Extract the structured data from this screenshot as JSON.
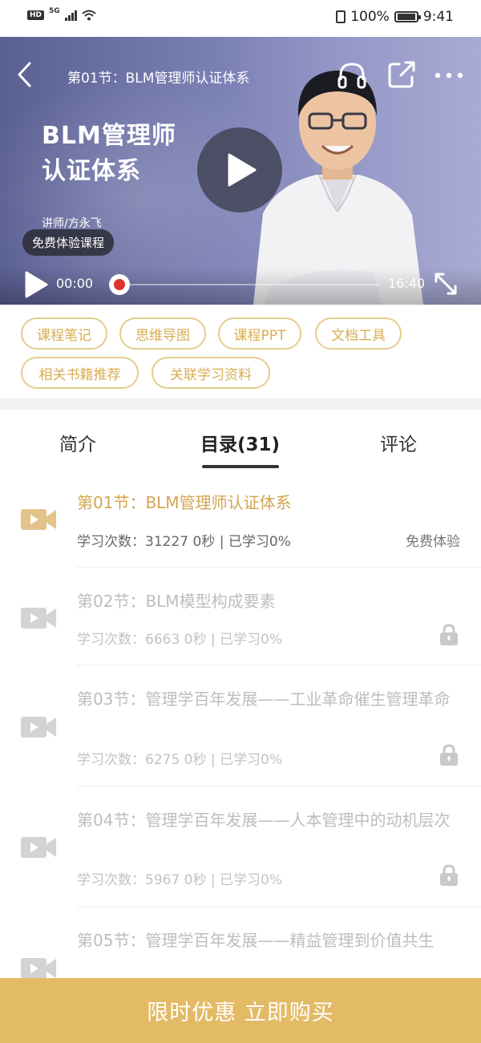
{
  "status_bar": {
    "hd": "HD",
    "network": "5G",
    "battery_percent": "100%",
    "time": "9:41"
  },
  "video": {
    "title": "第01节：BLM管理师认证体系",
    "course_name_line1": "BLM管理师",
    "course_name_line2": "认证体系",
    "teacher": "讲师/方永飞",
    "trial_badge": "免费体验课程",
    "current_time": "00:00",
    "total_time": "16:40",
    "progress": 0,
    "icons": [
      "back-icon",
      "headphone-icon",
      "share-icon",
      "more-icon",
      "play-icon",
      "record-icon",
      "fullscreen-icon"
    ]
  },
  "tools": {
    "tags": [
      "课程笔记",
      "思维导图",
      "课程PPT",
      "文档工具",
      "相关书籍推荐",
      "关联学习资料"
    ]
  },
  "tabs": {
    "items": [
      "简介",
      "目录(31)",
      "评论"
    ],
    "active_index": 1
  },
  "lessons": [
    {
      "title": "第01节：BLM管理师认证体系",
      "meta": "学习次数：31227   0秒 | 已学习0%",
      "status": "免费体验",
      "locked": false
    },
    {
      "title": "第02节：BLM模型构成要素",
      "meta": "学习次数：6663   0秒 | 已学习0%",
      "status": "",
      "locked": true
    },
    {
      "title": "第03节：管理学百年发展——工业革命催生管理革命",
      "meta": "学习次数：6275   0秒 | 已学习0%",
      "status": "",
      "locked": true
    },
    {
      "title": "第04节：管理学百年发展——人本管理中的动机层次",
      "meta": "学习次数：5967   0秒 | 已学习0%",
      "status": "",
      "locked": true
    },
    {
      "title": "第05节：管理学百年发展——精益管理到价值共生",
      "meta": "",
      "status": "",
      "locked": true
    }
  ],
  "buy_bar": {
    "label": "限时优惠 立即购买"
  },
  "colors": {
    "accent": "#e3ba65",
    "tag_border": "#e6cc8e",
    "tag_text": "#d9ad52",
    "locked_text": "#bdbdbd"
  }
}
